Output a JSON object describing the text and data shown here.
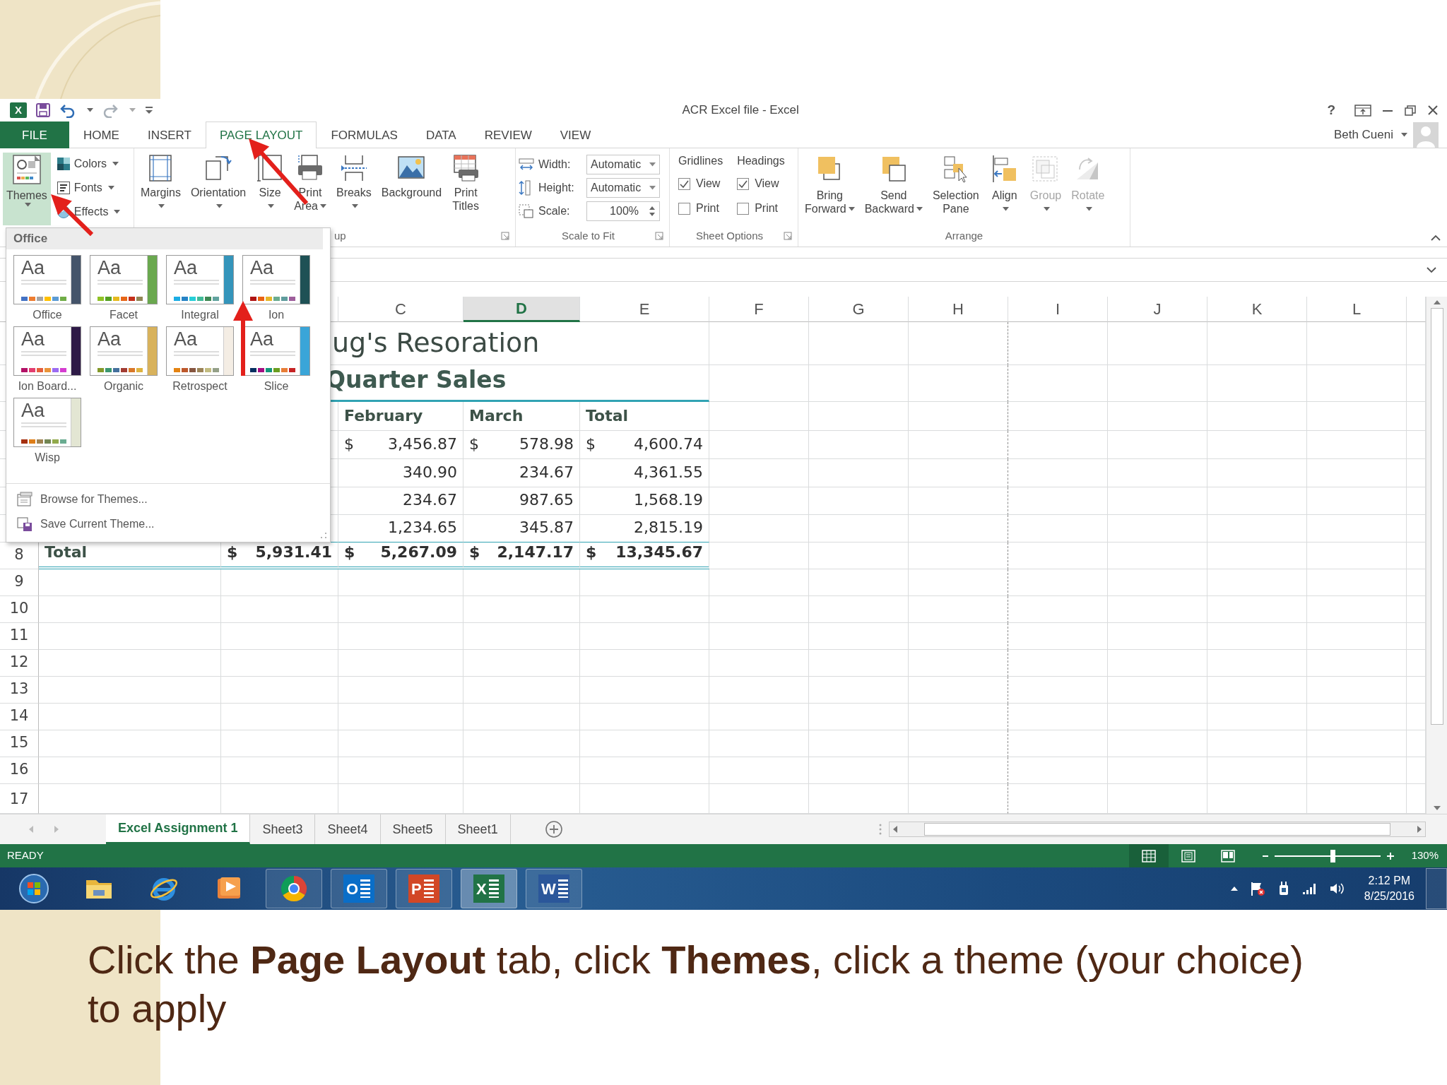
{
  "slide": {
    "caption": "Click the **Page Layout** tab, click **Themes**, click a theme (your choice) to apply"
  },
  "window": {
    "app_letter": "X",
    "title": "ACR Excel file - Excel",
    "help": "?",
    "user": "Beth Cueni"
  },
  "tabs": [
    {
      "label": "FILE",
      "kind": "file",
      "selected": false
    },
    {
      "label": "HOME",
      "kind": "tab",
      "selected": false
    },
    {
      "label": "INSERT",
      "kind": "tab",
      "selected": false
    },
    {
      "label": "PAGE LAYOUT",
      "kind": "tab",
      "selected": true
    },
    {
      "label": "FORMULAS",
      "kind": "tab",
      "selected": false
    },
    {
      "label": "DATA",
      "kind": "tab",
      "selected": false
    },
    {
      "label": "REVIEW",
      "kind": "tab",
      "selected": false
    },
    {
      "label": "VIEW",
      "kind": "tab",
      "selected": false
    }
  ],
  "ribbon": {
    "themes": {
      "label": "Themes",
      "expanded": true,
      "options": [
        {
          "label": "Colors"
        },
        {
          "label": "Fonts"
        },
        {
          "label": "Effects"
        }
      ]
    },
    "page_setup": {
      "label": "up",
      "buttons": [
        {
          "lines": [
            "Margins"
          ],
          "dropdown": true
        },
        {
          "lines": [
            "Orientation"
          ],
          "dropdown": true
        },
        {
          "lines": [
            "Size"
          ],
          "dropdown": true
        },
        {
          "lines": [
            "Print",
            "Area"
          ],
          "dropdown": true
        },
        {
          "lines": [
            "Breaks"
          ],
          "dropdown": true
        },
        {
          "lines": [
            "Background"
          ],
          "dropdown": false
        },
        {
          "lines": [
            "Print",
            "Titles"
          ],
          "dropdown": false
        }
      ]
    },
    "scale_to_fit": {
      "label": "Scale to Fit",
      "fields": [
        {
          "label": "Width:",
          "value": "Automatic",
          "kind": "select"
        },
        {
          "label": "Height:",
          "value": "Automatic",
          "kind": "select"
        },
        {
          "label": "Scale:",
          "value": "100%",
          "kind": "spin"
        }
      ]
    },
    "sheet_options": {
      "label": "Sheet Options",
      "columns": [
        {
          "heading": "Gridlines",
          "options": [
            {
              "label": "View",
              "checked": true
            },
            {
              "label": "Print",
              "checked": false
            }
          ]
        },
        {
          "heading": "Headings",
          "options": [
            {
              "label": "View",
              "checked": true
            },
            {
              "label": "Print",
              "checked": false
            }
          ]
        }
      ]
    },
    "arrange": {
      "label": "Arrange",
      "buttons": [
        {
          "lines": [
            "Bring",
            "Forward"
          ],
          "dropdown": true,
          "disabled": false
        },
        {
          "lines": [
            "Send",
            "Backward"
          ],
          "dropdown": true,
          "disabled": false
        },
        {
          "lines": [
            "Selection",
            "Pane"
          ],
          "dropdown": false,
          "disabled": false
        },
        {
          "lines": [
            "Align"
          ],
          "dropdown": true,
          "disabled": false
        },
        {
          "lines": [
            "Group"
          ],
          "dropdown": true,
          "disabled": true
        },
        {
          "lines": [
            "Rotate"
          ],
          "dropdown": true,
          "disabled": true
        }
      ]
    }
  },
  "theme_gallery": {
    "heading": "Office",
    "themes": [
      {
        "name": "Office",
        "sample": "Aa",
        "color": "#44546a",
        "swatches": [
          {
            "color": "#4472c4"
          },
          {
            "color": "#ed7d31"
          },
          {
            "color": "#a5a5a5"
          },
          {
            "color": "#ffc000"
          },
          {
            "color": "#5b9bd5"
          },
          {
            "color": "#70ad47"
          }
        ]
      },
      {
        "name": "Facet",
        "sample": "Aa",
        "color": "#6aa84f",
        "swatches": [
          {
            "color": "#90c226"
          },
          {
            "color": "#54a021"
          },
          {
            "color": "#e6b91e"
          },
          {
            "color": "#e76618"
          },
          {
            "color": "#c42f1a"
          },
          {
            "color": "#918655"
          }
        ]
      },
      {
        "name": "Integral",
        "sample": "Aa",
        "color": "#3494ba",
        "swatches": [
          {
            "color": "#1cade4"
          },
          {
            "color": "#2683c6"
          },
          {
            "color": "#27ced7"
          },
          {
            "color": "#42ba97"
          },
          {
            "color": "#3e8853"
          },
          {
            "color": "#62a39f"
          }
        ]
      },
      {
        "name": "Ion",
        "sample": "Aa",
        "color": "#1e5155",
        "swatches": [
          {
            "color": "#b01513"
          },
          {
            "color": "#ea6312"
          },
          {
            "color": "#e6b729"
          },
          {
            "color": "#6aac90"
          },
          {
            "color": "#5f9c9d"
          },
          {
            "color": "#9e5e9b"
          }
        ]
      },
      {
        "name": "Ion Board...",
        "sample": "Aa",
        "color": "#2e1a47",
        "swatches": [
          {
            "color": "#b31166"
          },
          {
            "color": "#e33d6f"
          },
          {
            "color": "#e45f3c"
          },
          {
            "color": "#e9943a"
          },
          {
            "color": "#9b6bf2"
          },
          {
            "color": "#d53dd0"
          }
        ]
      },
      {
        "name": "Organic",
        "sample": "Aa",
        "color": "#d8b25c",
        "swatches": [
          {
            "color": "#83992a"
          },
          {
            "color": "#3c9770"
          },
          {
            "color": "#44709d"
          },
          {
            "color": "#a23c33"
          },
          {
            "color": "#d97828"
          },
          {
            "color": "#deb340"
          }
        ]
      },
      {
        "name": "Retrospect",
        "sample": "Aa",
        "color": "#f4ede4",
        "swatches": [
          {
            "color": "#e48312"
          },
          {
            "color": "#bd582c"
          },
          {
            "color": "#865640"
          },
          {
            "color": "#9b8357"
          },
          {
            "color": "#c2bc80"
          },
          {
            "color": "#94a088"
          }
        ]
      },
      {
        "name": "Slice",
        "sample": "Aa",
        "color": "#3aa5d8",
        "swatches": [
          {
            "color": "#052f61"
          },
          {
            "color": "#a50e82"
          },
          {
            "color": "#14967c"
          },
          {
            "color": "#6a9e1f"
          },
          {
            "color": "#e87d37"
          },
          {
            "color": "#c62324"
          }
        ]
      },
      {
        "name": "Wisp",
        "sample": "Aa",
        "color": "#e3e6d3",
        "swatches": [
          {
            "color": "#a53010"
          },
          {
            "color": "#de7e18"
          },
          {
            "color": "#9f8351"
          },
          {
            "color": "#728653"
          },
          {
            "color": "#92aa4c"
          },
          {
            "color": "#6aac91"
          }
        ]
      }
    ],
    "actions": [
      {
        "label": "Browse for Themes..."
      },
      {
        "label": "Save Current Theme..."
      }
    ]
  },
  "sheet": {
    "columns": [
      {
        "label": "C",
        "selected": false
      },
      {
        "label": "D",
        "selected": true
      },
      {
        "label": "E",
        "selected": false
      },
      {
        "label": "F",
        "selected": false
      },
      {
        "label": "G",
        "selected": false
      },
      {
        "label": "H",
        "selected": false
      },
      {
        "label": "I",
        "selected": false
      },
      {
        "label": "J",
        "selected": false
      },
      {
        "label": "K",
        "selected": false
      },
      {
        "label": "L",
        "selected": false
      }
    ],
    "title": "ug's Resoration",
    "subtitle": "Quarter Sales",
    "header_row": [
      "February",
      "March",
      "Total"
    ],
    "data_rows": [
      [
        {
          "symbol": "$",
          "amount": "3,456.87"
        },
        {
          "symbol": "$",
          "amount": "578.98"
        },
        {
          "symbol": "$",
          "amount": "4,600.74"
        }
      ],
      [
        {
          "amount": "340.90"
        },
        {
          "amount": "234.67"
        },
        {
          "amount": "4,361.55"
        }
      ],
      [
        {
          "amount": "234.67"
        },
        {
          "amount": "987.65"
        },
        {
          "amount": "1,568.19"
        }
      ],
      [
        {
          "amount": "1,234.65"
        },
        {
          "amount": "345.87"
        },
        {
          "amount": "2,815.19"
        }
      ]
    ],
    "total_row": {
      "number": "8",
      "label": "Total",
      "cells": [
        {
          "symbol": "$",
          "amount": "5,931.41"
        },
        {
          "symbol": "$",
          "amount": "5,267.09"
        },
        {
          "symbol": "$",
          "amount": "2,147.17"
        },
        {
          "symbol": "$",
          "amount": "13,345.67"
        }
      ]
    },
    "empty_rows": [
      "9",
      "10",
      "11",
      "12",
      "13",
      "14",
      "15",
      "16",
      "17"
    ]
  },
  "sheet_tabs": [
    {
      "label": "Excel Assignment 1",
      "selected": true
    },
    {
      "label": "Sheet3",
      "selected": false
    },
    {
      "label": "Sheet4",
      "selected": false
    },
    {
      "label": "Sheet5",
      "selected": false
    },
    {
      "label": "Sheet1",
      "selected": false
    }
  ],
  "status_bar": {
    "mode": "READY",
    "views": [
      {
        "selected": true
      },
      {
        "selected": false
      },
      {
        "selected": false
      }
    ],
    "zoom": {
      "level": 0.55,
      "reading": "130%"
    }
  },
  "taskbar": {
    "apps": [
      {
        "kind": "start",
        "running": false,
        "selected": false
      },
      {
        "kind": "folder",
        "running": false,
        "selected": false
      },
      {
        "kind": "browser",
        "running": false,
        "selected": false
      },
      {
        "kind": "player",
        "running": false,
        "selected": false
      },
      {
        "kind": "wheel",
        "running": true,
        "selected": false
      },
      {
        "kind": "tile",
        "letter": "O",
        "color": "#0a6ec8",
        "running": true,
        "selected": false
      },
      {
        "kind": "tile",
        "letter": "P",
        "color": "#d24726",
        "running": true,
        "selected": false
      },
      {
        "kind": "tile",
        "letter": "X",
        "color": "#217346",
        "running": true,
        "selected": true
      },
      {
        "kind": "tile",
        "letter": "W",
        "color": "#2b579a",
        "running": true,
        "selected": false
      }
    ],
    "clock": {
      "time": "2:12 PM",
      "date": "8/25/2016"
    }
  }
}
